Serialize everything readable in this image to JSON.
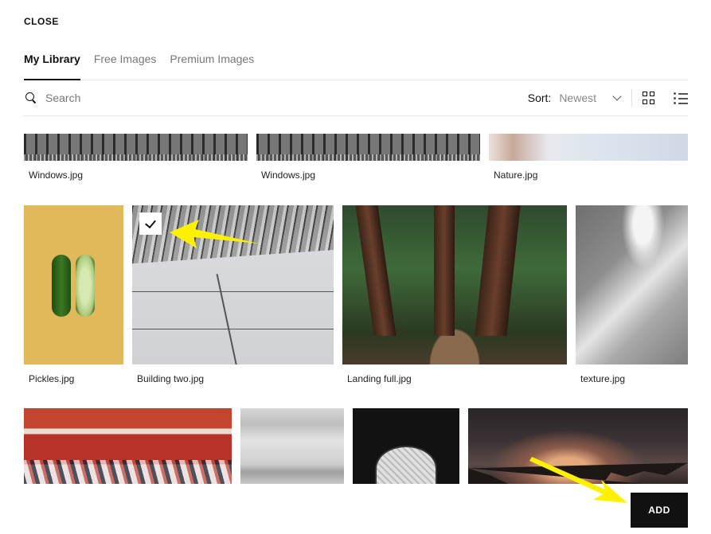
{
  "header": {
    "close_label": "CLOSE"
  },
  "tabs": [
    {
      "label": "My Library",
      "active": true
    },
    {
      "label": "Free Images",
      "active": false
    },
    {
      "label": "Premium Images",
      "active": false
    }
  ],
  "toolbar": {
    "search_placeholder": "Search",
    "search_value": "",
    "sort_label": "Sort:",
    "sort_value": "Newest",
    "view_modes": [
      {
        "icon": "grid-view-icon",
        "active": true
      },
      {
        "icon": "list-view-icon",
        "active": false
      }
    ]
  },
  "gallery": {
    "rows": [
      {
        "items": [
          {
            "name": "Windows.jpg",
            "selected": false
          },
          {
            "name": "Windows.jpg",
            "selected": false
          },
          {
            "name": "Nature.jpg",
            "selected": false
          }
        ]
      },
      {
        "items": [
          {
            "name": "Pickles.jpg",
            "selected": false
          },
          {
            "name": "Building two.jpg",
            "selected": true
          },
          {
            "name": "Landing full.jpg",
            "selected": false
          },
          {
            "name": "texture.jpg",
            "selected": false
          }
        ]
      },
      {
        "items": [
          {
            "name": "",
            "selected": false
          },
          {
            "name": "",
            "selected": false
          },
          {
            "name": "",
            "selected": false
          },
          {
            "name": "",
            "selected": false
          }
        ]
      }
    ]
  },
  "annotations": {
    "arrow_color": "#FFF200"
  },
  "footer": {
    "add_label": "ADD"
  }
}
